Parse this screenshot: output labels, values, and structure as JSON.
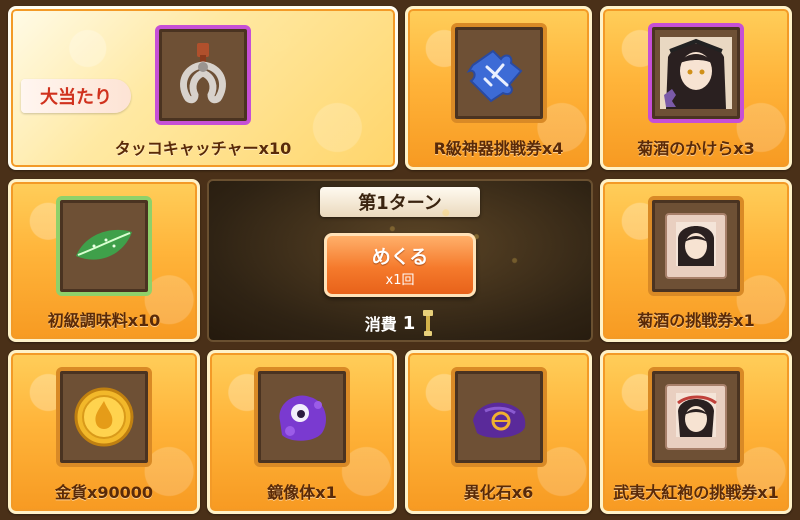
{
  "cards": {
    "c1": {
      "label": "タッコキャッチャーx10",
      "badge": "大当たり"
    },
    "c2": {
      "label": "R級神器挑戦券x4"
    },
    "c3": {
      "label": "菊酒のかけらx3"
    },
    "c4": {
      "label": "初級調味料x10"
    },
    "c5": {
      "label": "菊酒の挑戦券x1"
    },
    "c6": {
      "label": "金貨x90000"
    },
    "c7": {
      "label": "鏡像体x1"
    },
    "c8": {
      "label": "異化石x6"
    },
    "c9": {
      "label": "武夷大紅袍の挑戦券x1"
    }
  },
  "center": {
    "turn": "第1ターン",
    "flip_label": "めくる",
    "flip_count": "x1回",
    "cost_label": "消費",
    "cost_value": "1"
  },
  "colors": {
    "card_orange": "#ffb43a",
    "frame_orange": "#d98a26",
    "frame_purple": "#c64fd6",
    "frame_green": "#8fd16a",
    "button_orange": "#f57a2c",
    "jackpot_red": "#d0321e"
  },
  "icons": {
    "c1": "claw-icon",
    "c2": "puzzle-ticket-icon",
    "c3": "character-fragment-icon",
    "c4": "leaf-seasoning-icon",
    "c5": "character-ticket-icon",
    "c6": "gold-coin-icon",
    "c7": "purple-slime-icon",
    "c8": "purple-stone-icon",
    "c9": "character-ticket-icon",
    "cost": "key-icon"
  }
}
